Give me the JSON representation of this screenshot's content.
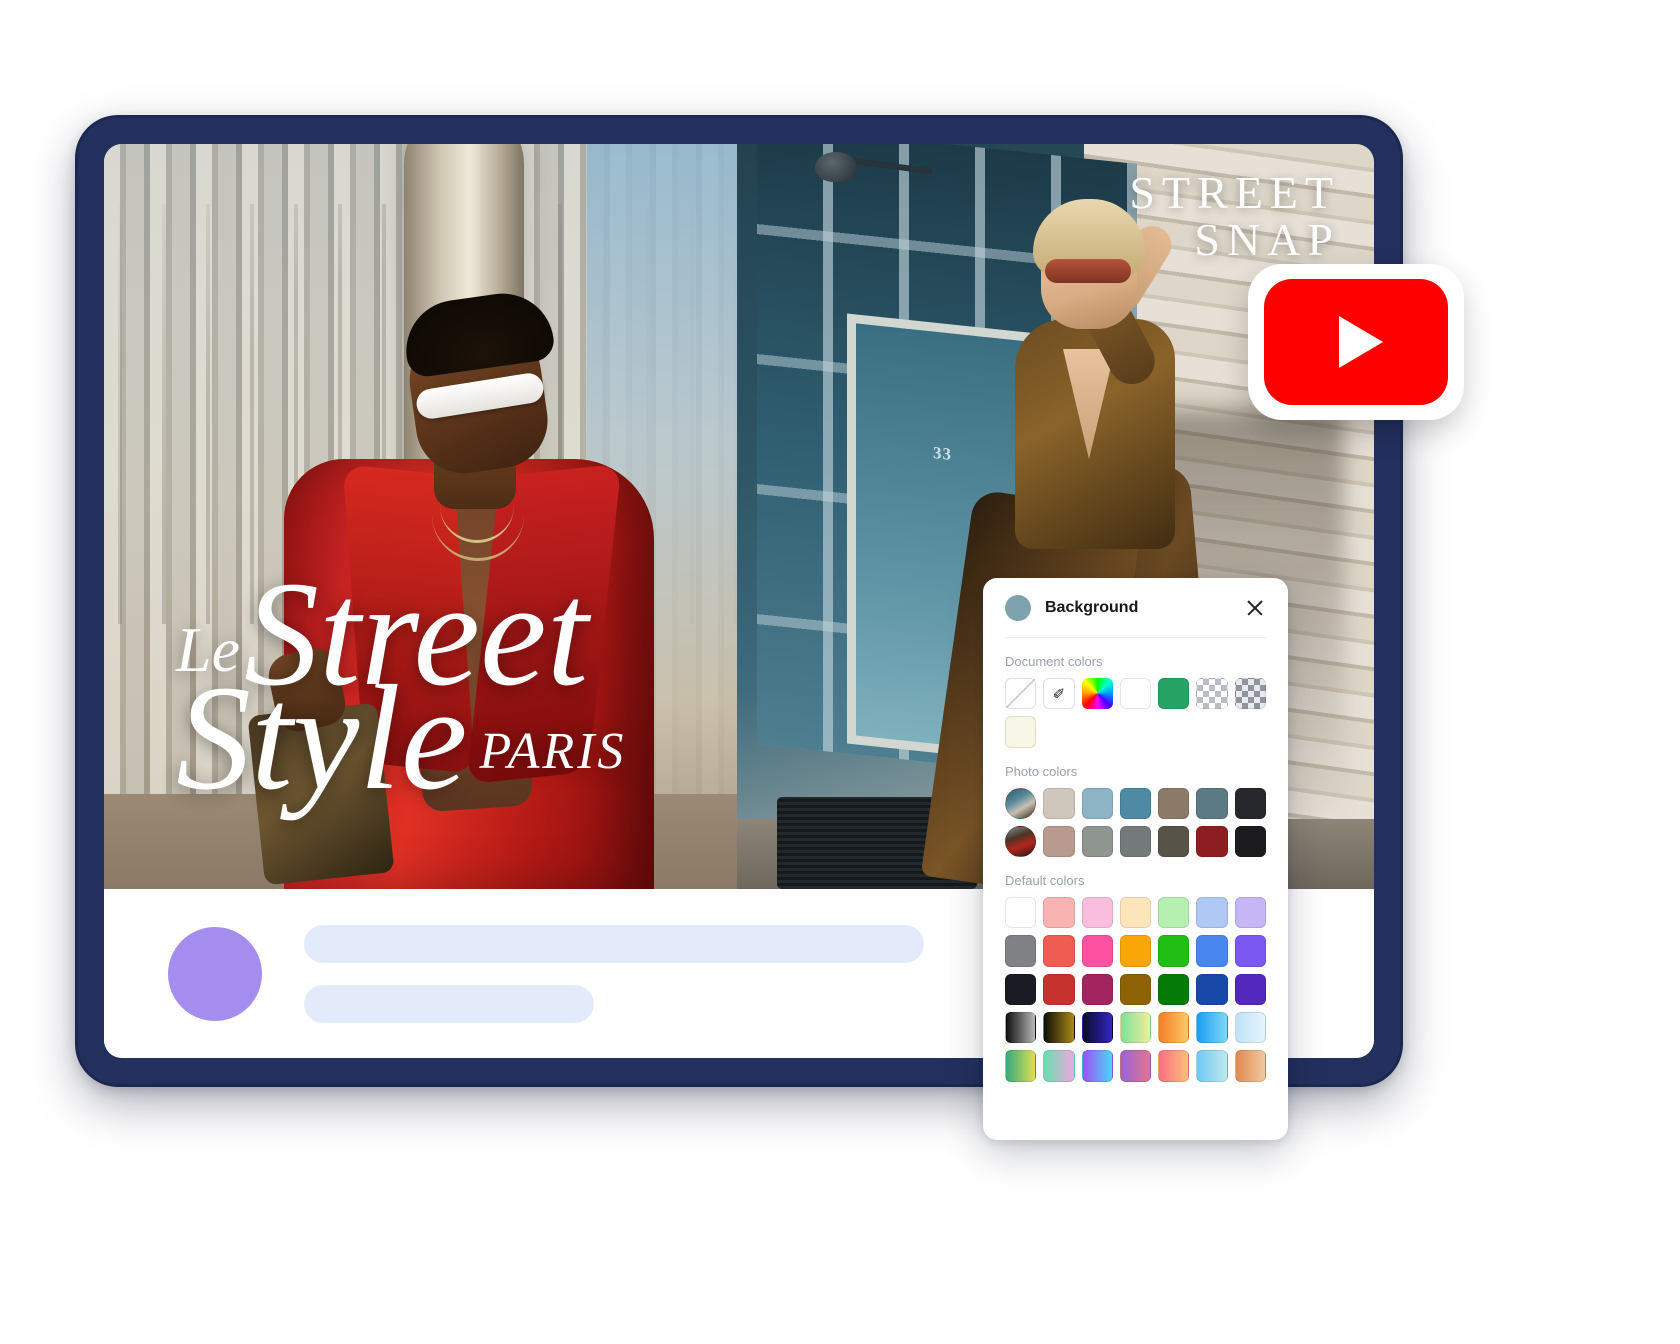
{
  "poster": {
    "logo": {
      "line1": "STREET",
      "line2": "SNAP"
    },
    "headline": {
      "le": "Le",
      "street": "Street",
      "style": "Style",
      "paris": "PARIS"
    },
    "door_number": "33"
  },
  "badge": {
    "name": "youtube-badge",
    "icon": "play-icon",
    "brand_color": "#FF0000"
  },
  "color_panel": {
    "title": "Background",
    "current_color": "#7FA3AE",
    "close_label": "×",
    "sections": [
      {
        "label": "Document colors",
        "swatches": [
          {
            "kind": "none",
            "color": "#FFFFFF",
            "name": "no-color"
          },
          {
            "kind": "picker",
            "color": "#FFFFFF",
            "name": "eyedropper"
          },
          {
            "kind": "wheel",
            "color": "#FF00FF",
            "name": "color-wheel"
          },
          {
            "kind": "solid",
            "color": "#FFFFFF",
            "name": "white"
          },
          {
            "kind": "solid",
            "color": "#27A366",
            "name": "green"
          },
          {
            "kind": "checker",
            "color": "#B8BCC4",
            "name": "transparent-light"
          },
          {
            "kind": "checker-dark",
            "color": "#8F949D",
            "name": "transparent-dark"
          },
          {
            "kind": "solid",
            "color": "#F7F6E7",
            "name": "ivory"
          }
        ]
      },
      {
        "label": "Photo colors",
        "swatches": [
          {
            "kind": "thumb1",
            "color": "#5A8B9C",
            "name": "photo-thumbnail-1"
          },
          {
            "kind": "solid",
            "color": "#CFC6BC",
            "name": "beige"
          },
          {
            "kind": "solid",
            "color": "#8DB4C4",
            "name": "light-blue"
          },
          {
            "kind": "solid",
            "color": "#4E8AA3",
            "name": "steel-blue"
          },
          {
            "kind": "solid",
            "color": "#8C7A69",
            "name": "taupe"
          },
          {
            "kind": "solid",
            "color": "#5C7A83",
            "name": "slate-teal"
          },
          {
            "kind": "solid",
            "color": "#26282B",
            "name": "near-black"
          },
          {
            "kind": "thumb2",
            "color": "#B3251D",
            "name": "photo-thumbnail-2"
          },
          {
            "kind": "solid",
            "color": "#B99A8E",
            "name": "dusty-rose"
          },
          {
            "kind": "solid",
            "color": "#8E968F",
            "name": "sage-gray"
          },
          {
            "kind": "solid",
            "color": "#747A79",
            "name": "gray"
          },
          {
            "kind": "solid",
            "color": "#585349",
            "name": "dark-olive-gray"
          },
          {
            "kind": "solid",
            "color": "#8E1E22",
            "name": "dark-red"
          },
          {
            "kind": "solid",
            "color": "#1C1C1E",
            "name": "black"
          }
        ]
      },
      {
        "label": "Default colors",
        "swatches": [
          {
            "kind": "solid",
            "color": "#FFFFFF",
            "name": "white"
          },
          {
            "kind": "solid",
            "color": "#F9B3B0",
            "name": "light-salmon"
          },
          {
            "kind": "solid",
            "color": "#F9BEDD",
            "name": "light-pink"
          },
          {
            "kind": "solid",
            "color": "#FCE5BB",
            "name": "light-peach"
          },
          {
            "kind": "solid",
            "color": "#B6F0B0",
            "name": "light-green"
          },
          {
            "kind": "solid",
            "color": "#AFC8F4",
            "name": "light-blue"
          },
          {
            "kind": "solid",
            "color": "#C6B6F6",
            "name": "light-purple"
          },
          {
            "kind": "solid",
            "color": "#808285",
            "name": "gray"
          },
          {
            "kind": "solid",
            "color": "#F05B52",
            "name": "coral-red"
          },
          {
            "kind": "solid",
            "color": "#FC52A0",
            "name": "hot-pink"
          },
          {
            "kind": "solid",
            "color": "#FBA607",
            "name": "orange"
          },
          {
            "kind": "solid",
            "color": "#21BE14",
            "name": "green"
          },
          {
            "kind": "solid",
            "color": "#4A86F0",
            "name": "blue"
          },
          {
            "kind": "solid",
            "color": "#7B58F2",
            "name": "purple"
          },
          {
            "kind": "solid",
            "color": "#191B22",
            "name": "black"
          },
          {
            "kind": "solid",
            "color": "#C6322D",
            "name": "red"
          },
          {
            "kind": "solid",
            "color": "#A32560",
            "name": "magenta"
          },
          {
            "kind": "solid",
            "color": "#8C6205",
            "name": "dark-gold"
          },
          {
            "kind": "solid",
            "color": "#067A07",
            "name": "dark-green"
          },
          {
            "kind": "solid",
            "color": "#1849A8",
            "name": "dark-blue"
          },
          {
            "kind": "solid",
            "color": "#5228BD",
            "name": "dark-purple"
          },
          {
            "kind": "gradient",
            "color": "linear-gradient(90deg,#0d0d0d,#b9b9b9)",
            "name": "black-gray-gradient"
          },
          {
            "kind": "gradient",
            "color": "linear-gradient(90deg,#0f0c05,#a98a18)",
            "name": "black-gold-gradient"
          },
          {
            "kind": "gradient",
            "color": "linear-gradient(90deg,#0a0a2a,#3426c4)",
            "name": "navy-blue-gradient"
          },
          {
            "kind": "gradient",
            "color": "linear-gradient(90deg,#7fdf9c,#f0ef9a)",
            "name": "green-yellow-gradient"
          },
          {
            "kind": "gradient",
            "color": "linear-gradient(90deg,#f77c26,#fbc96a)",
            "name": "orange-gradient"
          },
          {
            "kind": "gradient",
            "color": "linear-gradient(90deg,#1b9df0,#7fd8f7)",
            "name": "blue-cyan-gradient"
          },
          {
            "kind": "gradient",
            "color": "linear-gradient(90deg,#bfe3f7,#e6f3fb)",
            "name": "pale-blue-gradient"
          },
          {
            "kind": "gradient",
            "color": "linear-gradient(90deg,#35a97d,#dede52)",
            "name": "teal-yellow-gradient"
          },
          {
            "kind": "gradient",
            "color": "linear-gradient(90deg,#68dfae,#f0a8e0)",
            "name": "mint-pink-gradient"
          },
          {
            "kind": "gradient",
            "color": "linear-gradient(90deg,#a04ff5,#49d6f7)",
            "name": "purple-cyan-gradient"
          },
          {
            "kind": "gradient",
            "color": "linear-gradient(90deg,#9a63d6,#e3748e)",
            "name": "purple-rose-gradient"
          },
          {
            "kind": "gradient",
            "color": "linear-gradient(90deg,#fb6f86,#fbbf7a)",
            "name": "pink-peach-gradient"
          },
          {
            "kind": "gradient",
            "color": "linear-gradient(90deg,#6ec9f2,#bfe9ef)",
            "name": "sky-gradient"
          },
          {
            "kind": "gradient",
            "color": "linear-gradient(90deg,#e08a4f,#f3c9a0)",
            "name": "tan-gradient"
          }
        ]
      }
    ]
  }
}
